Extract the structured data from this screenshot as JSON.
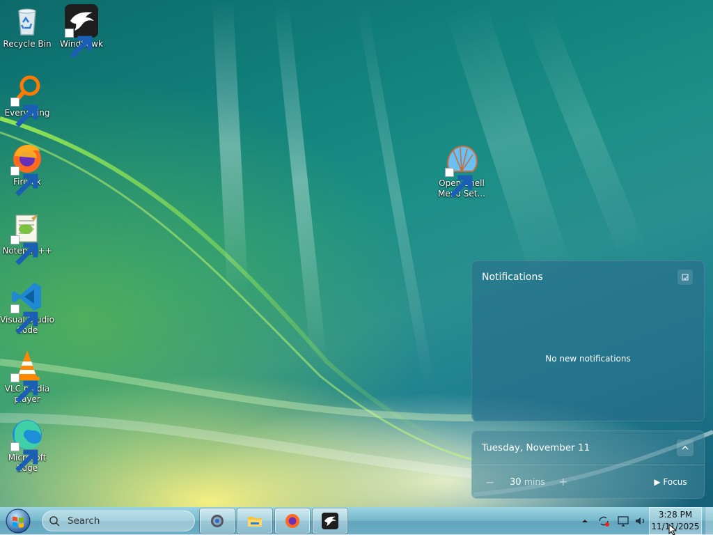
{
  "desktop": {
    "icons": [
      {
        "label_line1": "Recycle Bin",
        "label_line2": "",
        "icon": "recycle-bin-icon",
        "shortcut": false
      },
      {
        "label_line1": "Windhawk",
        "label_line2": "",
        "icon": "windhawk-icon",
        "shortcut": true
      },
      {
        "label_line1": "Everything",
        "label_line2": "",
        "icon": "everything-icon",
        "shortcut": true
      },
      {
        "label_line1": "Firefox",
        "label_line2": "",
        "icon": "firefox-icon",
        "shortcut": true
      },
      {
        "label_line1": "Notepad++",
        "label_line2": "",
        "icon": "notepadpp-icon",
        "shortcut": true
      },
      {
        "label_line1": "Visual Studio",
        "label_line2": "Code",
        "icon": "vscode-icon",
        "shortcut": true
      },
      {
        "label_line1": "VLC media",
        "label_line2": "player",
        "icon": "vlc-icon",
        "shortcut": true
      },
      {
        "label_line1": "Microsoft",
        "label_line2": "Edge",
        "icon": "edge-icon",
        "shortcut": true
      },
      {
        "label_line1": "Open-Shell",
        "label_line2": "Menu Set...",
        "icon": "open-shell-icon",
        "shortcut": true
      }
    ]
  },
  "notifications": {
    "title": "Notifications",
    "empty_text": "No new notifications"
  },
  "calendar": {
    "date": "Tuesday, November 11",
    "focus_minus": "−",
    "focus_minutes": "30",
    "focus_unit": "mins",
    "focus_plus": "+",
    "focus_button": "Focus"
  },
  "taskbar": {
    "search_placeholder": "Search",
    "pinned": [
      "settings-icon",
      "file-explorer-icon",
      "firefox-icon",
      "windhawk-icon"
    ],
    "tray": [
      "show-hidden-icons-chevron-icon",
      "sync-icon",
      "network-icon",
      "volume-icon"
    ],
    "time": "3:28 PM",
    "date": "11/11/2025"
  },
  "colors": {
    "accent": "#1f8f8f",
    "taskbar": "#7ab8cc"
  }
}
